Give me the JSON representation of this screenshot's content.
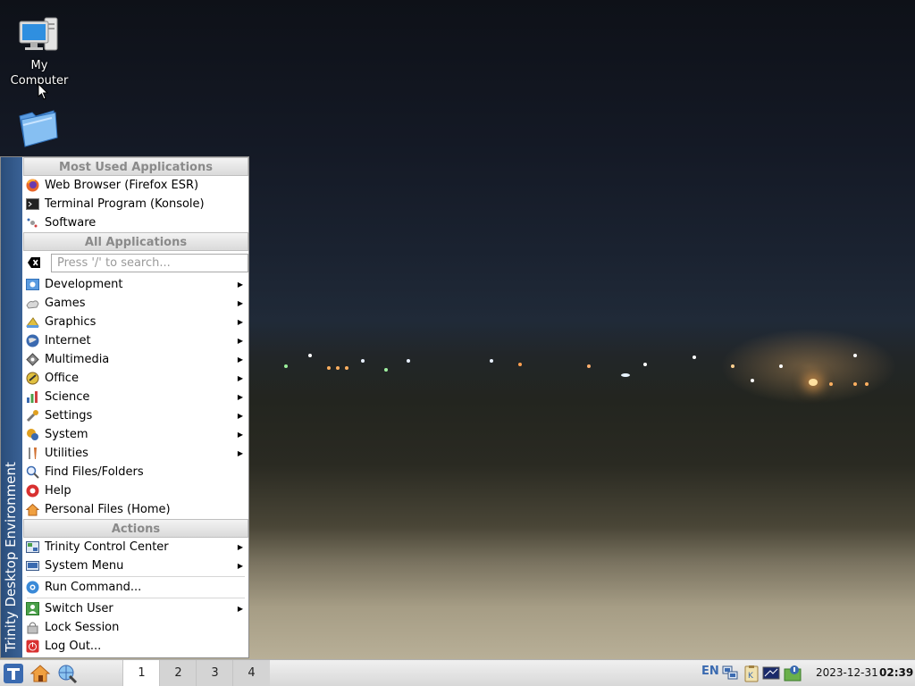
{
  "desktop": {
    "icons": [
      {
        "label": "My Computer"
      },
      {
        "label": ""
      }
    ]
  },
  "kmenu": {
    "side_title": "Trinity Desktop Environment",
    "most_used": {
      "header": "Most Used Applications",
      "items": [
        {
          "label": "Web Browser (Firefox ESR)",
          "icon": "firefox-icon"
        },
        {
          "label": "Terminal Program (Konsole)",
          "icon": "terminal-icon"
        },
        {
          "label": "Software",
          "icon": "software-icon"
        }
      ]
    },
    "all_apps": {
      "header": "All Applications",
      "search_placeholder": "Press '/' to search...",
      "items": [
        {
          "label": "Development",
          "icon": "development-icon",
          "submenu": true
        },
        {
          "label": "Games",
          "icon": "games-icon",
          "submenu": true
        },
        {
          "label": "Graphics",
          "icon": "graphics-icon",
          "submenu": true
        },
        {
          "label": "Internet",
          "icon": "internet-icon",
          "submenu": true
        },
        {
          "label": "Multimedia",
          "icon": "multimedia-icon",
          "submenu": true
        },
        {
          "label": "Office",
          "icon": "office-icon",
          "submenu": true
        },
        {
          "label": "Science",
          "icon": "science-icon",
          "submenu": true
        },
        {
          "label": "Settings",
          "icon": "settings-icon",
          "submenu": true
        },
        {
          "label": "System",
          "icon": "system-icon",
          "submenu": true
        },
        {
          "label": "Utilities",
          "icon": "utilities-icon",
          "submenu": true
        },
        {
          "label": "Find Files/Folders",
          "icon": "find-icon",
          "submenu": false
        },
        {
          "label": "Help",
          "icon": "help-icon",
          "submenu": false
        },
        {
          "label": "Personal Files (Home)",
          "icon": "home-icon",
          "submenu": false
        }
      ]
    },
    "actions": {
      "header": "Actions",
      "items": [
        {
          "label": "Trinity Control Center",
          "icon": "control-center-icon",
          "submenu": true
        },
        {
          "label": "System Menu",
          "icon": "system-menu-icon",
          "submenu": true
        },
        {
          "label": "Run Command...",
          "icon": "run-command-icon",
          "submenu": false
        },
        {
          "label": "Switch User",
          "icon": "switch-user-icon",
          "submenu": true
        },
        {
          "label": "Lock Session",
          "icon": "lock-icon",
          "submenu": false
        },
        {
          "label": "Log Out...",
          "icon": "logout-icon",
          "submenu": false
        }
      ]
    }
  },
  "taskbar": {
    "pager": [
      "1",
      "2",
      "3",
      "4"
    ],
    "active_desktop": "1",
    "tray": {
      "lang": "EN"
    },
    "clock": {
      "date": "2023-12-31",
      "time": "02:39"
    }
  },
  "colors": {
    "menu_side": "#2f5687",
    "accent": "#3a6ab0"
  }
}
